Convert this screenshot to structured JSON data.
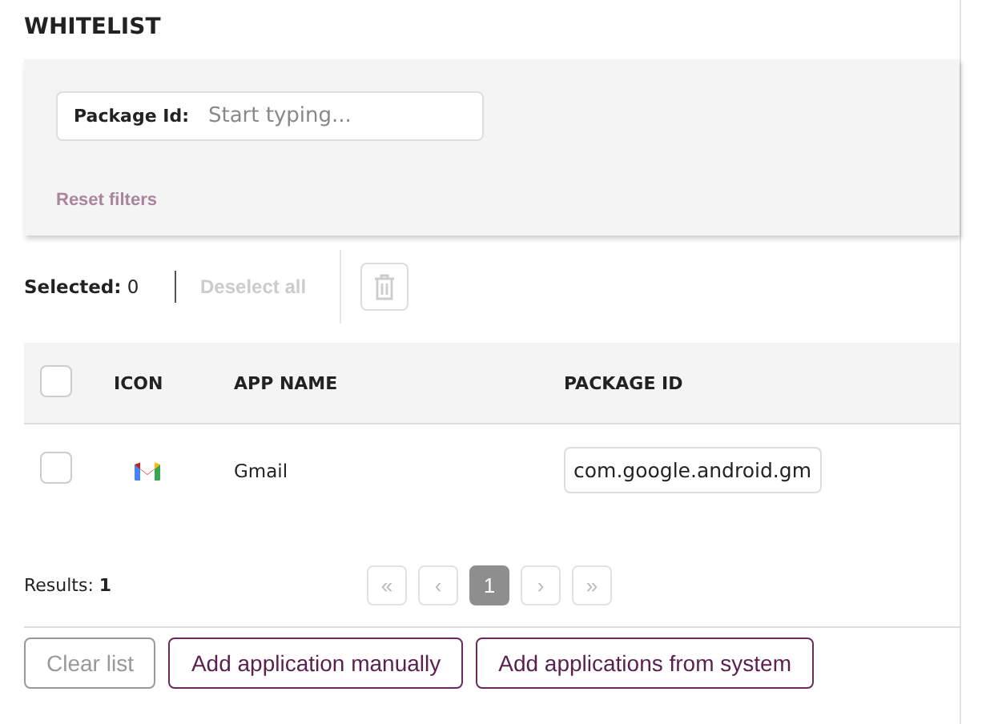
{
  "title": "WHITELIST",
  "filter": {
    "label": "Package Id:",
    "placeholder": "Start typing...",
    "reset": "Reset filters"
  },
  "selection": {
    "label": "Selected:",
    "count": "0",
    "deselect": "Deselect all",
    "deselect_disabled": true,
    "delete_disabled": true
  },
  "table": {
    "header_checked": false,
    "columns": [
      "ICON",
      "APP NAME",
      "PACKAGE ID"
    ],
    "rows": [
      {
        "checked": false,
        "app_name": "Gmail",
        "package_id": "com.google.android.gm"
      }
    ]
  },
  "results": {
    "label": "Results:",
    "count": "1"
  },
  "pagination": {
    "before": [
      {
        "label": "«",
        "disabled": true
      },
      {
        "label": "‹",
        "disabled": true
      }
    ],
    "pages": [
      {
        "label": "1",
        "selected": true
      }
    ],
    "after": [
      {
        "label": "›",
        "disabled": true
      },
      {
        "label": "»",
        "disabled": true
      }
    ]
  },
  "buttons": [
    {
      "label": "Clear list",
      "disabled": true
    },
    {
      "label": "Add application manually",
      "disabled": false
    },
    {
      "label": "Add applications from system",
      "disabled": false
    }
  ]
}
